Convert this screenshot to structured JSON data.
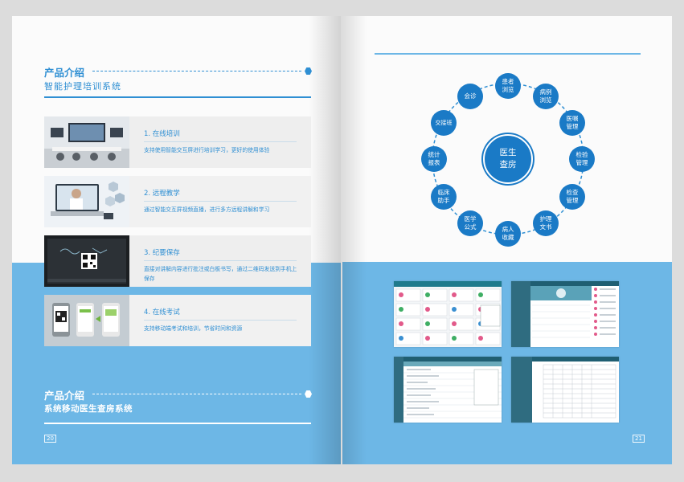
{
  "left_page": {
    "section1": {
      "title": "产品介绍",
      "subtitle": "智能护理培训系统"
    },
    "features": [
      {
        "title": "1. 在线培训",
        "desc": "支持使用智能交互屏进行培训学习，更好的使用体验",
        "thumb_icon": "training-room-photo"
      },
      {
        "title": "2. 远程教学",
        "desc": "通过智能交互屏视频直播，进行多方远程讲解和学习",
        "thumb_icon": "remote-teaching-photo"
      },
      {
        "title": "3. 纪要保存",
        "desc": "直接对讲解内容进行批注或白板书写，通过二维码发送到手机上保存",
        "thumb_icon": "qr-screen-photo"
      },
      {
        "title": "4. 在线考试",
        "desc": "支持移动端考试和培训，节省时间和资源",
        "thumb_icon": "mobile-exam-photo"
      }
    ],
    "section2": {
      "title": "产品介绍",
      "subtitle": "系统移动医生查房系统"
    },
    "page_number": "20"
  },
  "right_page": {
    "center": "医生\n查房",
    "nodes": [
      "患者\n浏览",
      "病例\n浏览",
      "医嘱\n管理",
      "检验\n管理",
      "检查\n管理",
      "护理\n文书",
      "病人\n收藏",
      "医学\n公式",
      "临床\n助手",
      "统计\n报表",
      "交接班",
      "会诊"
    ],
    "page_number": "21"
  },
  "colors": {
    "accent": "#2f8fd3",
    "band": "#6db7e6",
    "node": "#1a7ac6"
  }
}
